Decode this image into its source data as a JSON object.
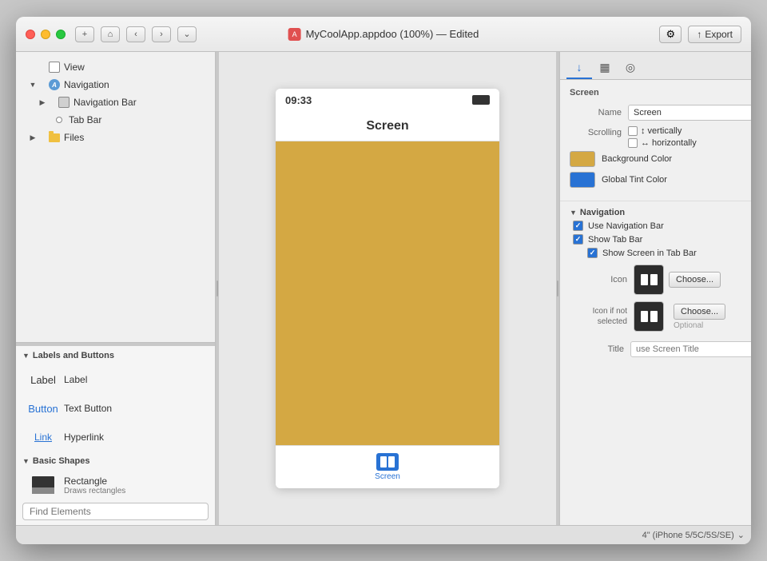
{
  "window": {
    "title": "MyCoolApp.appdoo (100%) — Edited",
    "app_icon_label": "A",
    "export_label": "Export"
  },
  "toolbar": {
    "plus_label": "+",
    "home_label": "⌂",
    "back_label": "‹",
    "forward_label": "›",
    "chevron_label": "⌄",
    "gear_label": "⚙",
    "export_icon": "↑"
  },
  "left_panel": {
    "tree": {
      "items": [
        {
          "label": "View",
          "indent": 1,
          "icon": "view"
        },
        {
          "label": "Navigation",
          "indent": 1,
          "icon": "nav",
          "expanded": true
        },
        {
          "label": "Navigation Bar",
          "indent": 2,
          "icon": "navbar"
        },
        {
          "label": "Tab Bar",
          "indent": 2,
          "icon": "tabbar"
        },
        {
          "label": "Files",
          "indent": 1,
          "icon": "folder"
        }
      ]
    }
  },
  "elements_panel": {
    "labels_buttons_section": "Labels and Buttons",
    "items": [
      {
        "name": "Label",
        "desc": "",
        "type": "label"
      },
      {
        "name": "Text Button",
        "desc": "",
        "type": "textbutton"
      },
      {
        "name": "Hyperlink",
        "desc": "",
        "type": "hyperlink"
      }
    ],
    "basic_shapes_section": "Basic Shapes",
    "shapes": [
      {
        "name": "Rectangle",
        "desc": "Draws rectangles",
        "type": "rect"
      }
    ],
    "find_placeholder": "Find Elements"
  },
  "canvas": {
    "phone": {
      "status_time": "09:33",
      "screen_title": "Screen",
      "tab_label": "Screen"
    }
  },
  "right_panel": {
    "tabs": [
      {
        "icon": "↓",
        "active": true
      },
      {
        "icon": "▦",
        "active": false
      },
      {
        "icon": "◎",
        "active": false
      }
    ],
    "screen_section": "Screen",
    "name_label": "Name",
    "name_value": "Screen",
    "scrolling_label": "Scrolling",
    "scroll_vertically": "↕ vertically",
    "scroll_horizontally": "↔ horizontally",
    "background_color_label": "Background Color",
    "background_color_value": "#d4a843",
    "global_tint_label": "Global Tint Color",
    "global_tint_value": "#2872d4",
    "navigation_section": "Navigation",
    "use_nav_bar_label": "Use Navigation Bar",
    "show_tab_bar_label": "Show Tab Bar",
    "show_screen_in_tab_label": "Show Screen in Tab Bar",
    "icon_label": "Icon",
    "icon_not_selected_label": "Icon if not selected",
    "choose_label": "Choose...",
    "optional_label": "Optional",
    "title_label": "Title",
    "title_placeholder": "use Screen Title"
  },
  "status_bar": {
    "device_label": "4\" (iPhone 5/5C/5S/SE)",
    "arrow_label": "⌄"
  }
}
